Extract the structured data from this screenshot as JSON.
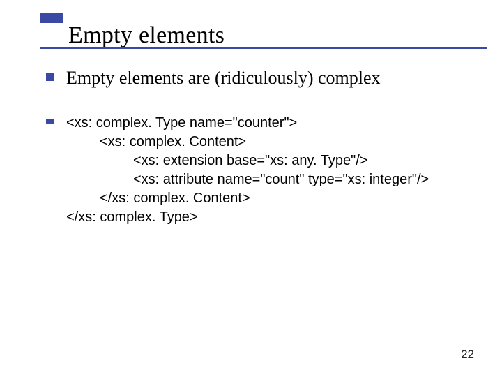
{
  "title": "Empty elements",
  "bullet1": "Empty elements are (ridiculously) complex",
  "code": {
    "l1": "<xs: complex. Type  name=\"counter\">",
    "l2": "<xs: complex. Content>",
    "l3": "<xs: extension  base=\"xs: any. Type\"/>",
    "l4": "<xs: attribute  name=\"count\"  type=\"xs: integer\"/>",
    "l5": "</xs: complex. Content>",
    "l6": "</xs: complex. Type>"
  },
  "page_number": "22"
}
